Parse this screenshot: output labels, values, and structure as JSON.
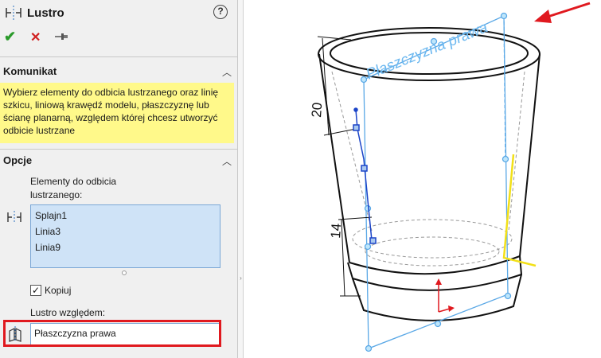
{
  "panel": {
    "title": "Lustro",
    "help_label": "?",
    "ok_symbol": "✔",
    "cancel_symbol": "✕"
  },
  "message_section": {
    "heading": "Komunikat",
    "text": "Wybierz elementy do odbicia lustrzanego oraz linię szkicu, liniową krawędź modelu, płaszczyznę lub ścianę planarną, względem której chcesz utworzyć odbicie lustrzane"
  },
  "options_section": {
    "heading": "Opcje",
    "entities_label": "Elementy do odbicia lustrzanego:",
    "entities": [
      "Splajn1",
      "Linia3",
      "Linia9"
    ],
    "copy_label": "Kopiuj",
    "copy_checked": "✓",
    "mirror_about_label": "Lustro względem:",
    "mirror_about_value": "Płaszczyzna prawa"
  },
  "viewport": {
    "plane_label": "Płaszczyzna prawa",
    "dim_top": "20",
    "dim_bottom": "14"
  },
  "icons": {
    "title_icon": "mirror-entities-icon",
    "pin": "pushpin-icon",
    "entities": "mirror-entities-icon",
    "mirror_about": "mirror-plane-icon"
  },
  "colors": {
    "message_bg": "#fff98a",
    "listbox_bg": "#cfe3f7",
    "highlight": "#e0191f",
    "plane": "#5aa8e6",
    "arrow": "#e0191f"
  }
}
